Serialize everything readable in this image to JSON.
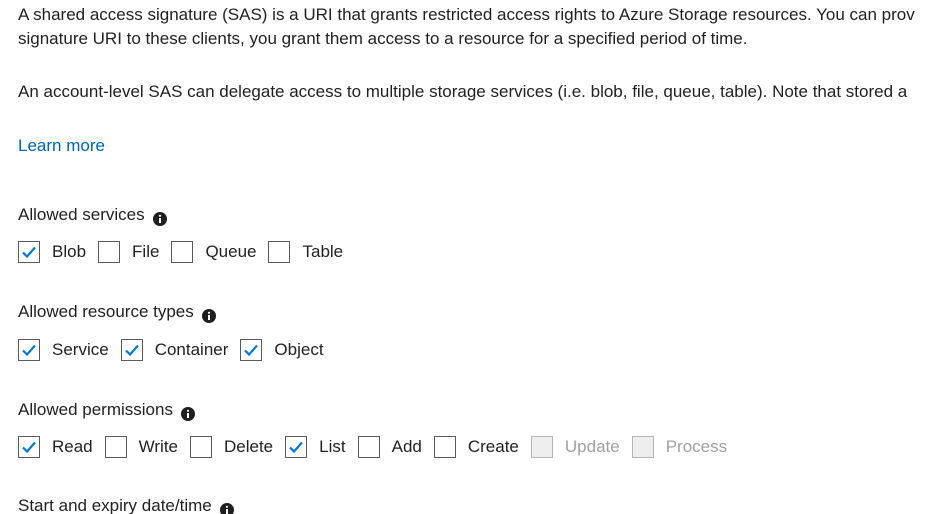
{
  "intro": {
    "line1": "A shared access signature (SAS) is a URI that grants restricted access rights to Azure Storage resources. You can prov",
    "line2": "signature URI to these clients, you grant them access to a resource for a specified period of time.",
    "line3": "An account-level SAS can delegate access to multiple storage services (i.e. blob, file, queue, table). Note that stored a",
    "learn_more": "Learn more"
  },
  "services": {
    "label": "Allowed services",
    "items": [
      {
        "label": "Blob",
        "checked": true
      },
      {
        "label": "File",
        "checked": false
      },
      {
        "label": "Queue",
        "checked": false
      },
      {
        "label": "Table",
        "checked": false
      }
    ]
  },
  "resource_types": {
    "label": "Allowed resource types",
    "items": [
      {
        "label": "Service",
        "checked": true
      },
      {
        "label": "Container",
        "checked": true
      },
      {
        "label": "Object",
        "checked": true
      }
    ]
  },
  "permissions": {
    "label": "Allowed permissions",
    "items": [
      {
        "label": "Read",
        "checked": true,
        "disabled": false
      },
      {
        "label": "Write",
        "checked": false,
        "disabled": false
      },
      {
        "label": "Delete",
        "checked": false,
        "disabled": false
      },
      {
        "label": "List",
        "checked": true,
        "disabled": false
      },
      {
        "label": "Add",
        "checked": false,
        "disabled": false
      },
      {
        "label": "Create",
        "checked": false,
        "disabled": false
      },
      {
        "label": "Update",
        "checked": false,
        "disabled": true
      },
      {
        "label": "Process",
        "checked": false,
        "disabled": true
      }
    ]
  },
  "datetime": {
    "label": "Start and expiry date/time"
  },
  "colors": {
    "link": "#0063b1",
    "checkmark": "#0078d4",
    "text": "#222222",
    "disabled_text": "#a0a0a0"
  },
  "icons": {
    "info": "info-icon",
    "check": "checkmark-icon"
  }
}
